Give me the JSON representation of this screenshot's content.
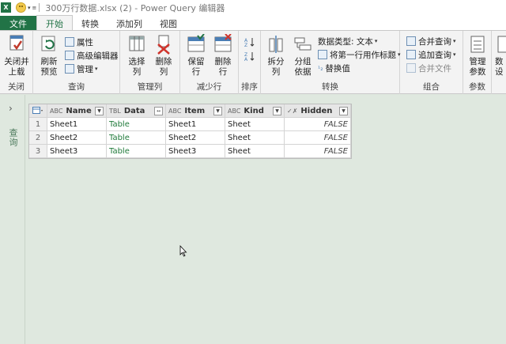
{
  "window": {
    "app_icon": "excel-icon",
    "title": "300万行数据.xlsx (2) - Power Query 编辑器"
  },
  "tabs": [
    {
      "label": "文件"
    },
    {
      "label": "开始"
    },
    {
      "label": "转换"
    },
    {
      "label": "添加列"
    },
    {
      "label": "视图"
    }
  ],
  "ribbon": {
    "close_group": {
      "label": "关闭",
      "close_load": "关闭并\n上载"
    },
    "query_group": {
      "label": "查询",
      "refresh_preview": "刷新\n预览",
      "properties": "属性",
      "advanced_editor": "高级编辑器",
      "manage": "管理"
    },
    "manage_columns_group": {
      "label": "管理列",
      "choose_columns": "选择\n列",
      "remove_columns": "删除\n列"
    },
    "reduce_rows_group": {
      "label": "减少行",
      "keep_rows": "保留\n行",
      "remove_rows": "删除\n行"
    },
    "sort_group": {
      "label": "排序"
    },
    "transform_group": {
      "label": "转换",
      "split_column": "拆分\n列",
      "group_by": "分组\n依据",
      "data_type": "数据类型: 文本",
      "first_row_header": "将第一行用作标题",
      "replace_values": "替换值"
    },
    "combine_group": {
      "label": "组合",
      "merge_queries": "合并查询",
      "append_queries": "追加查询",
      "combine_files": "合并文件"
    },
    "params_group": {
      "label": "参数",
      "manage_params": "管理\n参数"
    },
    "datasource_group": {
      "label": "数",
      "datasource": "数\n设"
    }
  },
  "left_nav": {
    "label": "查询"
  },
  "grid": {
    "columns": [
      {
        "type": "ABC",
        "name": "Name"
      },
      {
        "type": "TBL",
        "name": "Data"
      },
      {
        "type": "ABC",
        "name": "Item"
      },
      {
        "type": "ABC",
        "name": "Kind"
      },
      {
        "type": "✓✗",
        "name": "Hidden"
      }
    ],
    "rows": [
      {
        "num": "1",
        "name": "Sheet1",
        "data": "Table",
        "item": "Sheet1",
        "kind": "Sheet",
        "hidden": "FALSE"
      },
      {
        "num": "2",
        "name": "Sheet2",
        "data": "Table",
        "item": "Sheet2",
        "kind": "Sheet",
        "hidden": "FALSE"
      },
      {
        "num": "3",
        "name": "Sheet3",
        "data": "Table",
        "item": "Sheet3",
        "kind": "Sheet",
        "hidden": "FALSE"
      }
    ]
  },
  "colors": {
    "accent": "#217346",
    "background": "#dfe8df"
  }
}
